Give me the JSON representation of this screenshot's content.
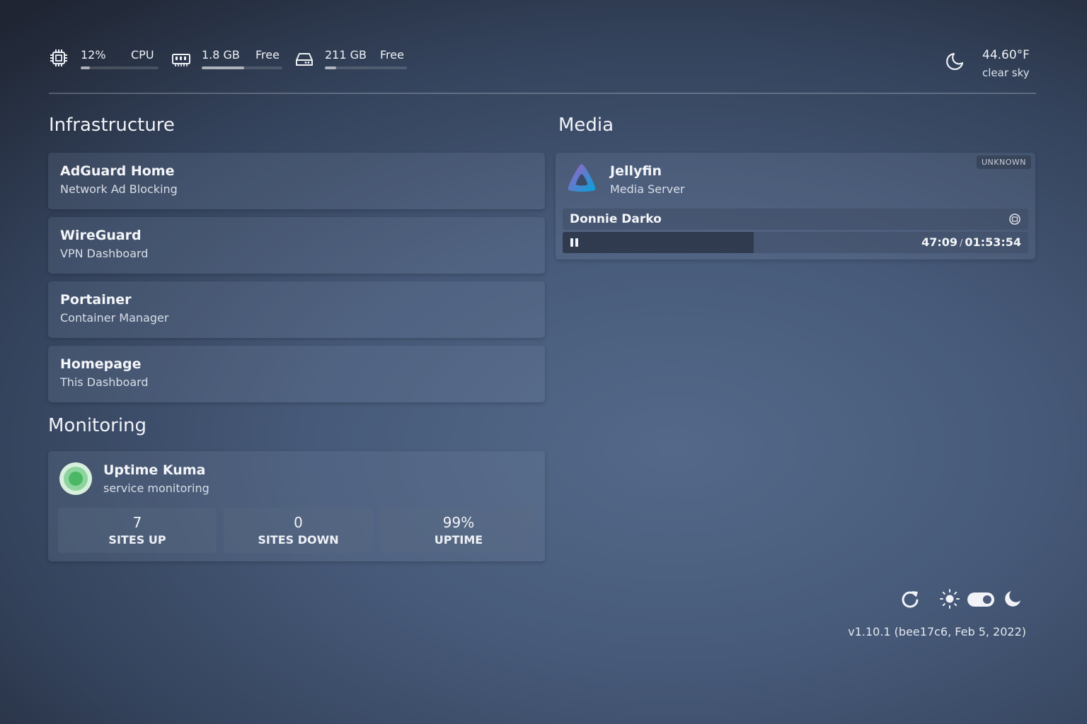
{
  "topbar": {
    "cpu": {
      "value": "12%",
      "label": "CPU",
      "percent": 12,
      "icon": "cpu-icon"
    },
    "memory": {
      "value": "1.8 GB",
      "label": "Free",
      "percent": 53,
      "icon": "memory-icon"
    },
    "disk": {
      "value": "211 GB",
      "label": "Free",
      "percent": 14,
      "icon": "disk-icon"
    },
    "weather": {
      "temperature": "44.60°F",
      "condition": "clear sky",
      "icon": "moon-icon"
    }
  },
  "infrastructure": {
    "title": "Infrastructure",
    "services": [
      {
        "name": "AdGuard Home",
        "description": "Network Ad Blocking"
      },
      {
        "name": "WireGuard",
        "description": "VPN Dashboard"
      },
      {
        "name": "Portainer",
        "description": "Container Manager"
      },
      {
        "name": "Homepage",
        "description": "This Dashboard"
      }
    ]
  },
  "monitoring": {
    "title": "Monitoring",
    "service": {
      "name": "Uptime Kuma",
      "description": "service monitoring",
      "stats": [
        {
          "value": "7",
          "label": "SITES UP"
        },
        {
          "value": "0",
          "label": "SITES DOWN"
        },
        {
          "value": "99%",
          "label": "UPTIME"
        }
      ]
    }
  },
  "media": {
    "title": "Media",
    "service": {
      "name": "Jellyfin",
      "description": "Media Server",
      "status_badge": "UNKNOWN",
      "now_playing": {
        "title": "Donnie Darko",
        "position": "47:09",
        "separator": "/",
        "duration": "01:53:54",
        "progress_percent": 41
      }
    }
  },
  "footer": {
    "version": "v1.10.1 (bee17c6, Feb 5, 2022)",
    "theme_toggle": "dark"
  }
}
